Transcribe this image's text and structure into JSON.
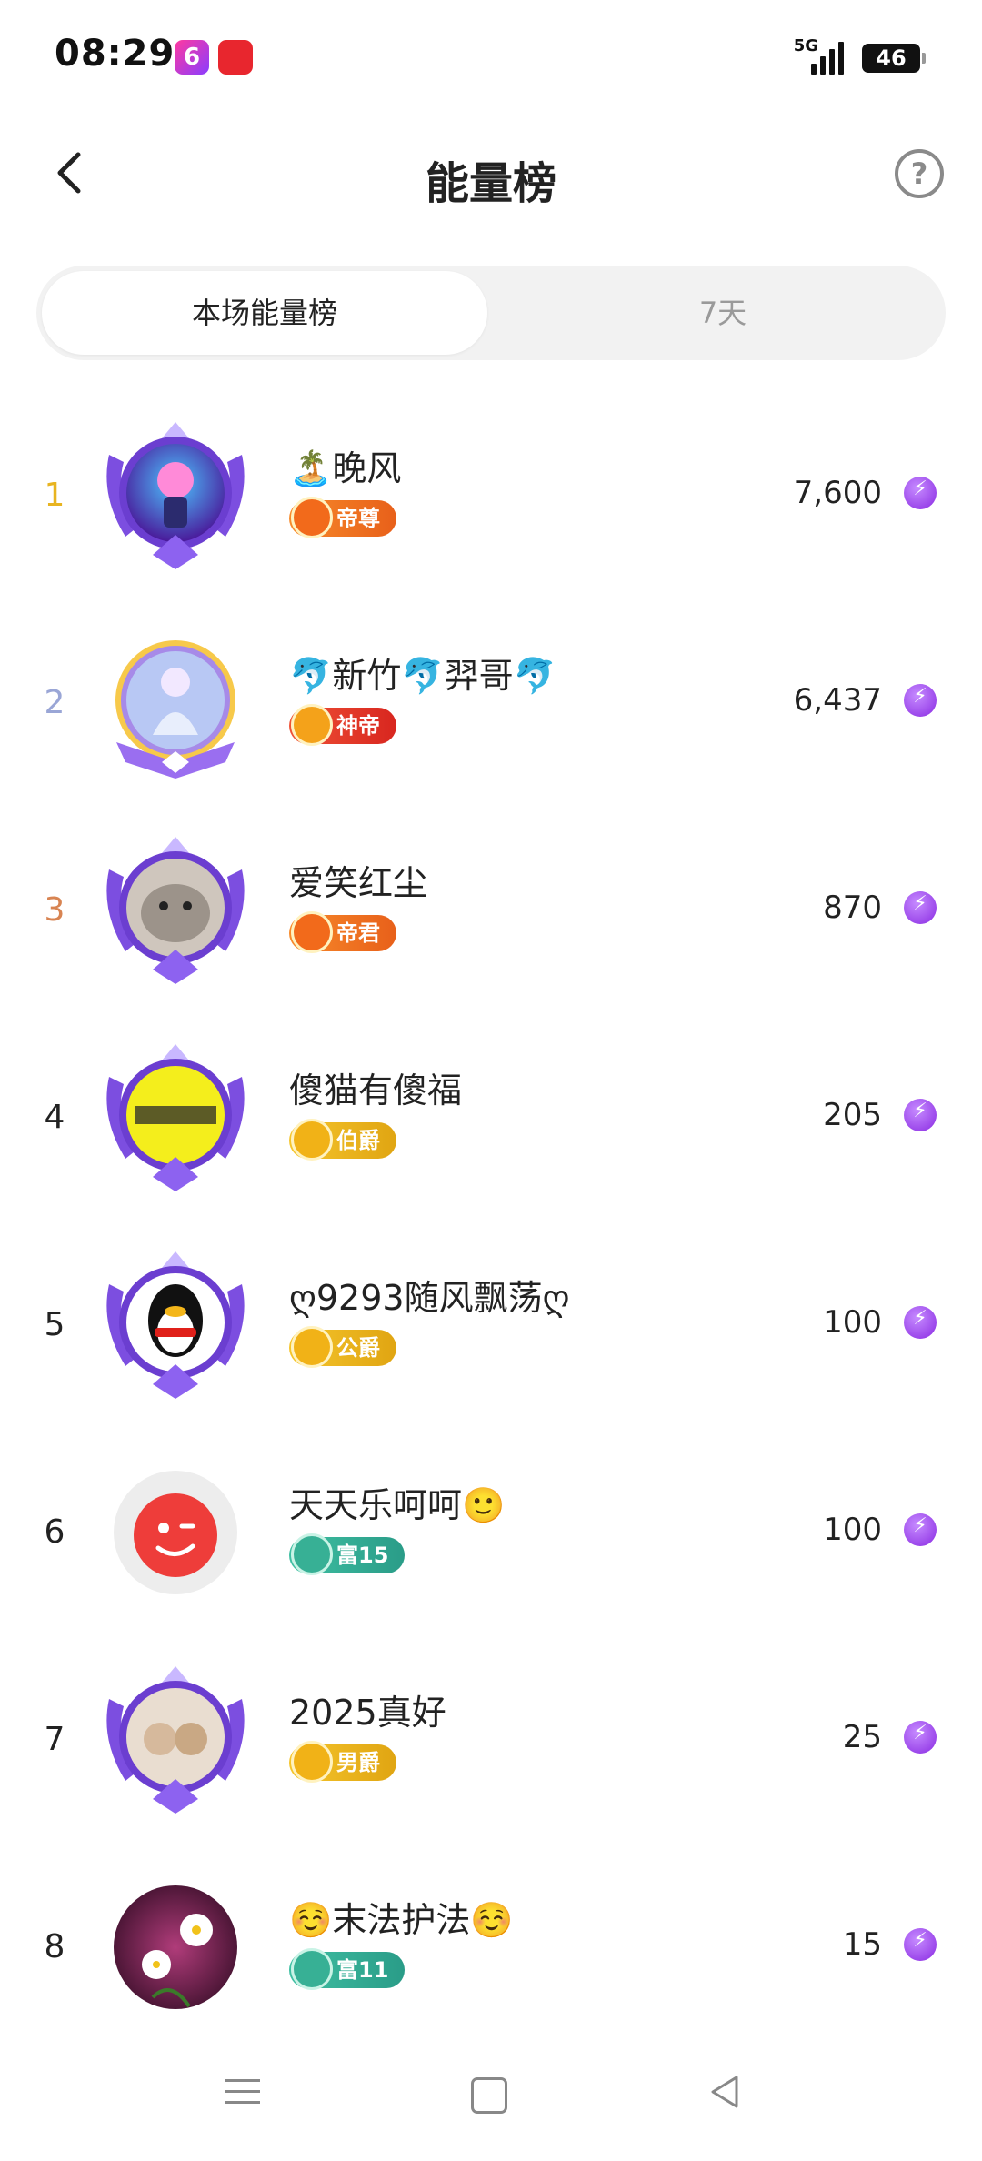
{
  "status": {
    "time": "08:29",
    "network": "5G",
    "battery": "46",
    "app_icons": [
      "video-app-icon",
      "shopping-618-icon"
    ]
  },
  "header": {
    "title": "能量榜",
    "back_icon": "chevron-left-icon",
    "help_icon": "question-circle-icon",
    "help_glyph": "?"
  },
  "tabs": [
    {
      "label": "本场能量榜",
      "active": true
    },
    {
      "label": "7天",
      "active": false
    }
  ],
  "rows": [
    {
      "rank": "1",
      "name": "🏝️晚风",
      "badge": "帝尊",
      "energy": "7,600"
    },
    {
      "rank": "2",
      "name": "🐬新竹🐬羿哥🐬",
      "badge": "神帝",
      "energy": "6,437"
    },
    {
      "rank": "3",
      "name": "爱笑红尘",
      "badge": "帝君",
      "energy": "870"
    },
    {
      "rank": "4",
      "name": "傻猫有傻福",
      "badge": "伯爵",
      "energy": "205"
    },
    {
      "rank": "5",
      "name": "ღ9293随风飘荡ღ",
      "badge": "公爵",
      "energy": "100"
    },
    {
      "rank": "6",
      "name": "天天乐呵呵🙂",
      "badge": "富15",
      "energy": "100"
    },
    {
      "rank": "7",
      "name": "2025真好",
      "badge": "男爵",
      "energy": "25"
    },
    {
      "rank": "8",
      "name": "☺️末法护法☺️",
      "badge": "富11",
      "energy": "15"
    }
  ],
  "colors": {
    "rank1": "#e8b420",
    "rank2": "#9aa6d6",
    "rank3": "#d88452",
    "energy_icon": "#8a2be2"
  },
  "energy_icon": "lightning-icon"
}
